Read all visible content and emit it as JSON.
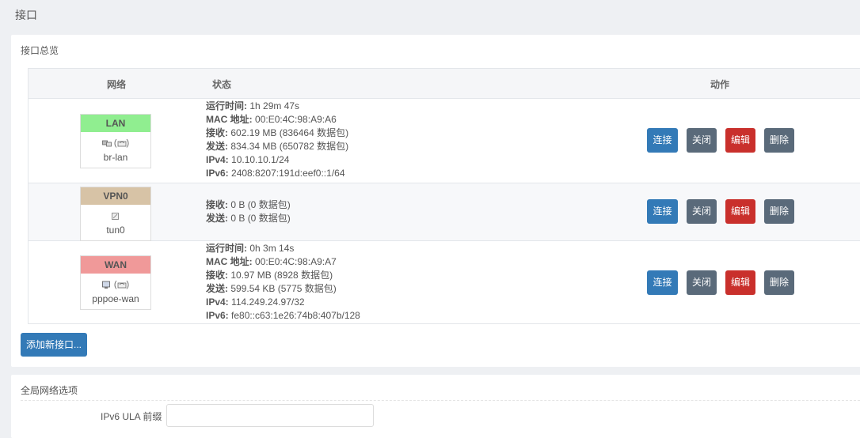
{
  "page": {
    "title": "接口"
  },
  "overview": {
    "heading": "接口总览",
    "columns": {
      "network": "网络",
      "status": "状态",
      "action": "动作"
    },
    "interfaces": [
      {
        "name": "LAN",
        "color": "#90ee90",
        "icons": [
          "ethernet-switch-icon",
          "wifi-icon"
        ],
        "icon_text": "(",
        "icon_text2": ")",
        "device": "br-lan",
        "status": [
          {
            "label": "运行时间:",
            "value": "1h 29m 47s"
          },
          {
            "label": "MAC 地址:",
            "value": "00:E0:4C:98:A9:A6"
          },
          {
            "label": "接收:",
            "value": "602.19 MB (836464 数据包)"
          },
          {
            "label": "发送:",
            "value": "834.34 MB (650782 数据包)"
          },
          {
            "label": "IPv4:",
            "value": "10.10.10.1/24"
          },
          {
            "label": "IPv6:",
            "value": "2408:8207:191d:eef0::1/64"
          }
        ]
      },
      {
        "name": "VPN0",
        "color": "#d7c3a6",
        "icons": [
          "tunnel-icon"
        ],
        "device": "tun0",
        "status": [
          {
            "label": "接收:",
            "value": "0 B (0 数据包)"
          },
          {
            "label": "发送:",
            "value": "0 B (0 数据包)"
          }
        ]
      },
      {
        "name": "WAN",
        "color": "#f09999",
        "icons": [
          "pppoe-icon",
          "wifi-icon"
        ],
        "icon_text": "(",
        "icon_text2": ")",
        "device": "pppoe-wan",
        "status": [
          {
            "label": "运行时间:",
            "value": "0h 3m 14s"
          },
          {
            "label": "MAC 地址:",
            "value": "00:E0:4C:98:A9:A7"
          },
          {
            "label": "接收:",
            "value": "10.97 MB (8928 数据包)"
          },
          {
            "label": "发送:",
            "value": "599.54 KB (5775 数据包)"
          },
          {
            "label": "IPv4:",
            "value": "114.249.24.97/32"
          },
          {
            "label": "IPv6:",
            "value": "fe80::c63:1e26:74b8:407b/128"
          }
        ]
      }
    ],
    "buttons": {
      "connect": "连接",
      "close": "关闭",
      "edit": "编辑",
      "delete": "删除"
    },
    "add_button": "添加新接口..."
  },
  "global": {
    "heading": "全局网络选项",
    "ula_label": "IPv6 ULA 前缀",
    "ula_value": ""
  },
  "colors": {
    "primary": "#337ab7",
    "danger": "#c9302c",
    "secondary": "#5a6a7a"
  }
}
